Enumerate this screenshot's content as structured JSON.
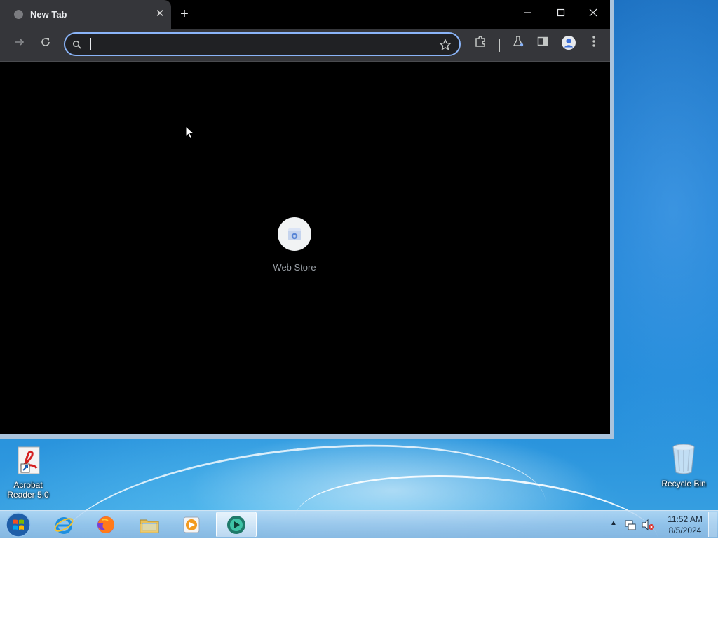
{
  "browser": {
    "tab": {
      "title": "New Tab"
    },
    "omnibox": {
      "value": "",
      "placeholder": ""
    },
    "shortcuts": [
      {
        "label": "Web Store"
      }
    ]
  },
  "desktop": {
    "icons": [
      {
        "label_line1": "Acrobat",
        "label_line2": "Reader 5.0"
      },
      {
        "label_line1": "Recycle Bin"
      }
    ]
  },
  "taskbar": {
    "clock": {
      "time": "11:52 AM",
      "date": "8/5/2024"
    }
  },
  "colors": {
    "omnibox_focus": "#8ab4f8",
    "browser_toolbar": "#35363a",
    "page_background": "#000000"
  }
}
